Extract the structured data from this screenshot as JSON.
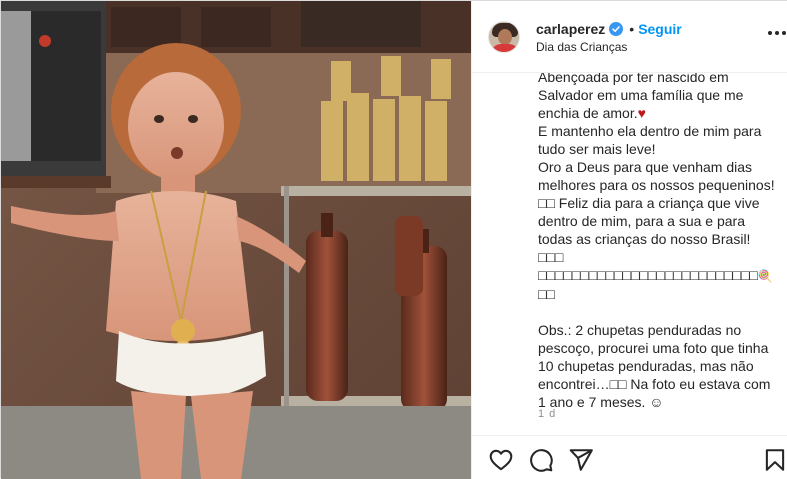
{
  "post": {
    "username": "carlaperez",
    "follow_label": "Seguir",
    "dot": "•",
    "location": "Dia das Crianças",
    "time_ago": "1 d",
    "caption_lines": [
      "Abençoada por ter nascido em",
      "Salvador em uma família que me",
      "enchia de amor.",
      "E mantenho ela dentro de mim para",
      "tudo ser mais leve!",
      "Oro a Deus para que venham dias",
      "melhores para os nossos pequeninos!",
      "□□ Feliz dia para a criança que vive",
      "dentro de mim, para a sua e para",
      "todas as crianças do nosso Brasil! □□□",
      "□□□□□□□□□□□□□□□□□□□□□□□□□□",
      "□□",
      "Obs.: 2 chupetas penduradas no",
      "pescoço, procurei uma foto que tinha",
      "10 chupetas penduradas, mas não",
      "encontrei…□□ Na foto eu estava com",
      "1 ano e 7 meses. ☺"
    ],
    "heart_glyph": "♥",
    "lollipop_glyph": "🍭",
    "caption_line11_tail": "□□ □□"
  },
  "icons": {
    "verified": "verified-badge-icon",
    "more": "more-options-icon",
    "like": "heart-icon",
    "comment": "comment-icon",
    "share": "share-icon",
    "save": "bookmark-icon"
  },
  "colors": {
    "accent": "#0095f6",
    "text": "#262626",
    "muted": "#8e8e8e",
    "heart": "#c0191b"
  }
}
